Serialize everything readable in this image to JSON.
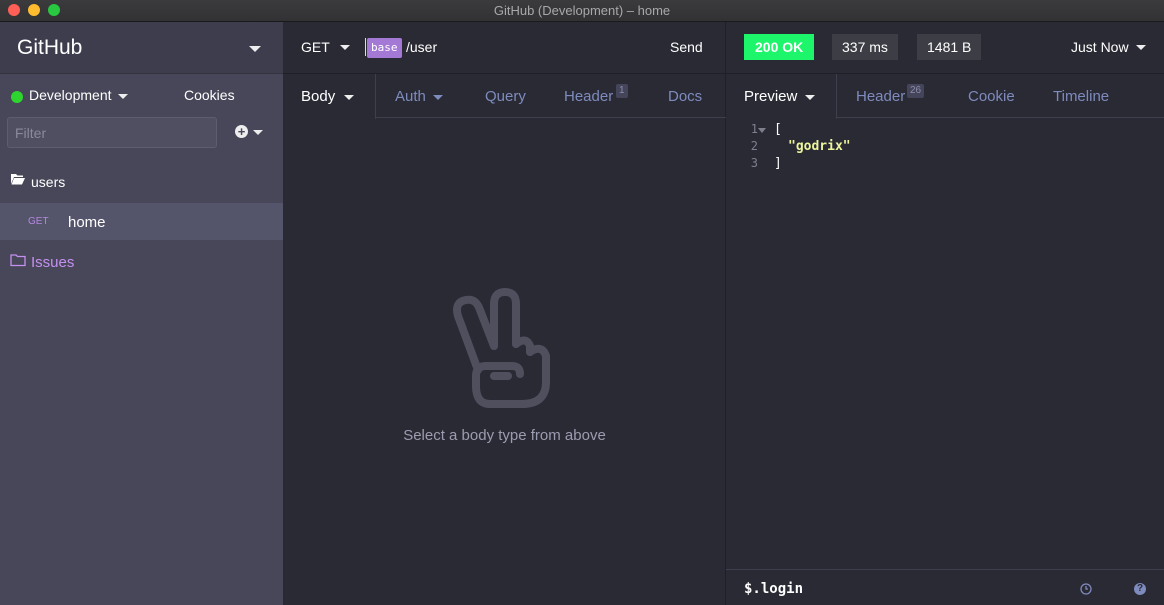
{
  "window": {
    "title": "GitHub (Development) – home"
  },
  "sidebar": {
    "workspace": "GitHub",
    "environment": "Development",
    "cookies_label": "Cookies",
    "filter_placeholder": "Filter",
    "folders": [
      {
        "name": "users",
        "requests": [
          {
            "method": "GET",
            "name": "home"
          }
        ]
      },
      {
        "name": "Issues"
      }
    ]
  },
  "request": {
    "method": "GET",
    "url_tag": "base",
    "url_path": "/user",
    "send_label": "Send",
    "tabs": {
      "body": "Body",
      "auth": "Auth",
      "query": "Query",
      "header": "Header",
      "header_count": "1",
      "docs": "Docs"
    },
    "empty_message": "Select a body type from above"
  },
  "response": {
    "status": "200 OK",
    "time": "337 ms",
    "size": "1481 B",
    "history": "Just Now",
    "tabs": {
      "preview": "Preview",
      "header": "Header",
      "header_count": "26",
      "cookie": "Cookie",
      "timeline": "Timeline"
    },
    "lines": [
      {
        "num": "1",
        "text": "["
      },
      {
        "num": "2",
        "text": "\"godrix\""
      },
      {
        "num": "3",
        "text": "]"
      }
    ],
    "filter": "$.login"
  },
  "colors": {
    "accent": "#a479d6",
    "status_ok": "#1df56b",
    "env_dot": "#2fd52f",
    "folder_purple": "#c590ef"
  }
}
